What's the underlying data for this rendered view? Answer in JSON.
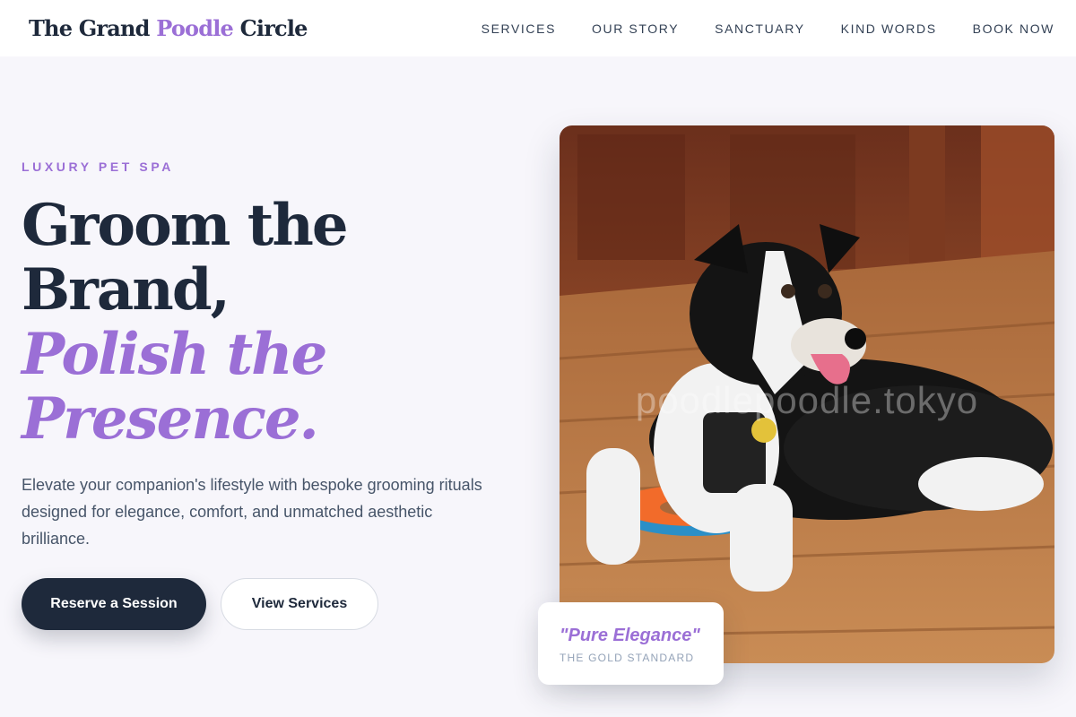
{
  "header": {
    "brand_part1": "The Grand ",
    "brand_accent": "Poodle",
    "brand_part2": " Circle",
    "nav": [
      "SERVICES",
      "OUR STORY",
      "SANCTUARY",
      "KIND WORDS",
      "BOOK NOW"
    ]
  },
  "hero": {
    "eyebrow": "LUXURY PET SPA",
    "headline_lines": [
      "Groom the",
      "Brand,"
    ],
    "headline_accent_lines": [
      "Polish the",
      "Presence."
    ],
    "subtext": "Elevate your companion's lifestyle with bespoke grooming rituals designed for elegance, comfort, and unmatched aesthetic brilliance.",
    "primary_button": "Reserve a Session",
    "secondary_button": "View Services"
  },
  "photo": {
    "watermark": "poodlepoodle.tokyo",
    "subject": "black-and-white dog lying on wooden deck with frisbee"
  },
  "badge": {
    "quote": "\"Pure Elegance\"",
    "label": "THE GOLD STANDARD"
  },
  "colors": {
    "accent": "#9b6fd6",
    "dark": "#1e293b",
    "background": "#f7f6fb"
  }
}
